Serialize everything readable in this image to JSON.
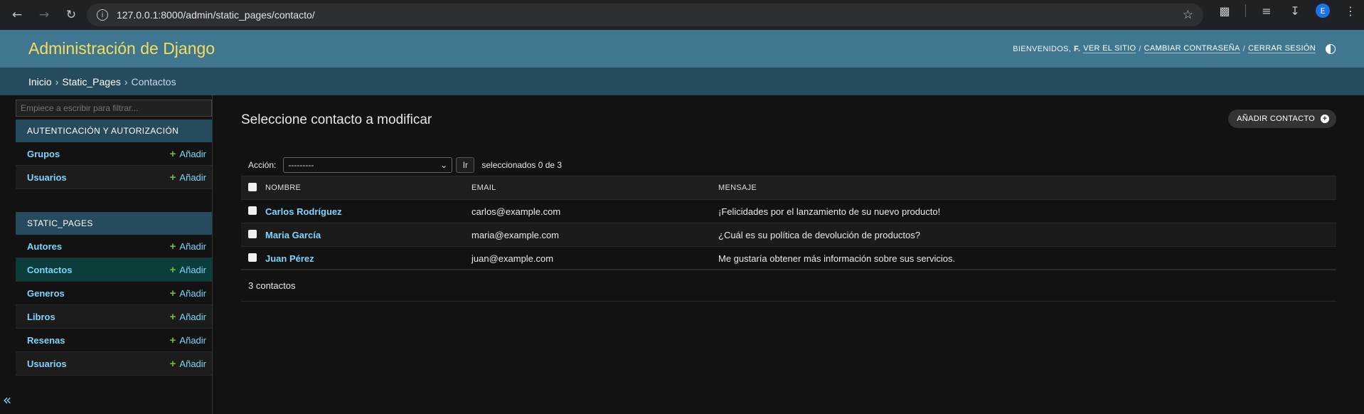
{
  "browser": {
    "url": "127.0.0.1:8000/admin/static_pages/contacto/",
    "profile_initial": "E"
  },
  "header": {
    "branding": "Administración de Django",
    "welcome": "BIENVENIDOS,",
    "user": "F.",
    "view_site": "VER EL SITIO",
    "change_password": "CAMBIAR CONTRASEÑA",
    "logout": "CERRAR SESIÓN"
  },
  "breadcrumbs": [
    "Inicio",
    "Static_Pages",
    "Contactos"
  ],
  "sidebar": {
    "filter_placeholder": "Empiece a escribir para filtrar...",
    "add_label": "Añadir",
    "modules": [
      {
        "caption": "AUTENTICACIÓN Y AUTORIZACIÓN",
        "items": [
          "Grupos",
          "Usuarios"
        ]
      },
      {
        "caption": "STATIC_PAGES",
        "items": [
          "Autores",
          "Contactos",
          "Generos",
          "Libros",
          "Resenas",
          "Usuarios"
        ]
      }
    ],
    "collapse_glyph": "«"
  },
  "content": {
    "title": "Seleccione contacto a modificar",
    "add_button": "AÑADIR CONTACTO",
    "action_label": "Acción:",
    "action_selected": "---------",
    "go_label": "Ir",
    "selection_counter": "seleccionados 0 de 3",
    "columns": [
      "NOMBRE",
      "EMAIL",
      "MENSAJE"
    ],
    "rows": [
      {
        "nombre": "Carlos Rodríguez",
        "email": "carlos@example.com",
        "mensaje": "¡Felicidades por el lanzamiento de su nuevo producto!"
      },
      {
        "nombre": "Maria García",
        "email": "maria@example.com",
        "mensaje": "¿Cuál es su política de devolución de productos?"
      },
      {
        "nombre": "Juan Pérez",
        "email": "juan@example.com",
        "mensaje": "Me gustaría obtener más información sobre sus servicios."
      }
    ],
    "paginator": "3 contactos"
  },
  "colors": {
    "header_bg": "#417690",
    "branding": "#f5dd5d",
    "breadcrumb_bg": "#264b5d",
    "link": "#81d4fa",
    "add_plus": "#70bf2b"
  }
}
